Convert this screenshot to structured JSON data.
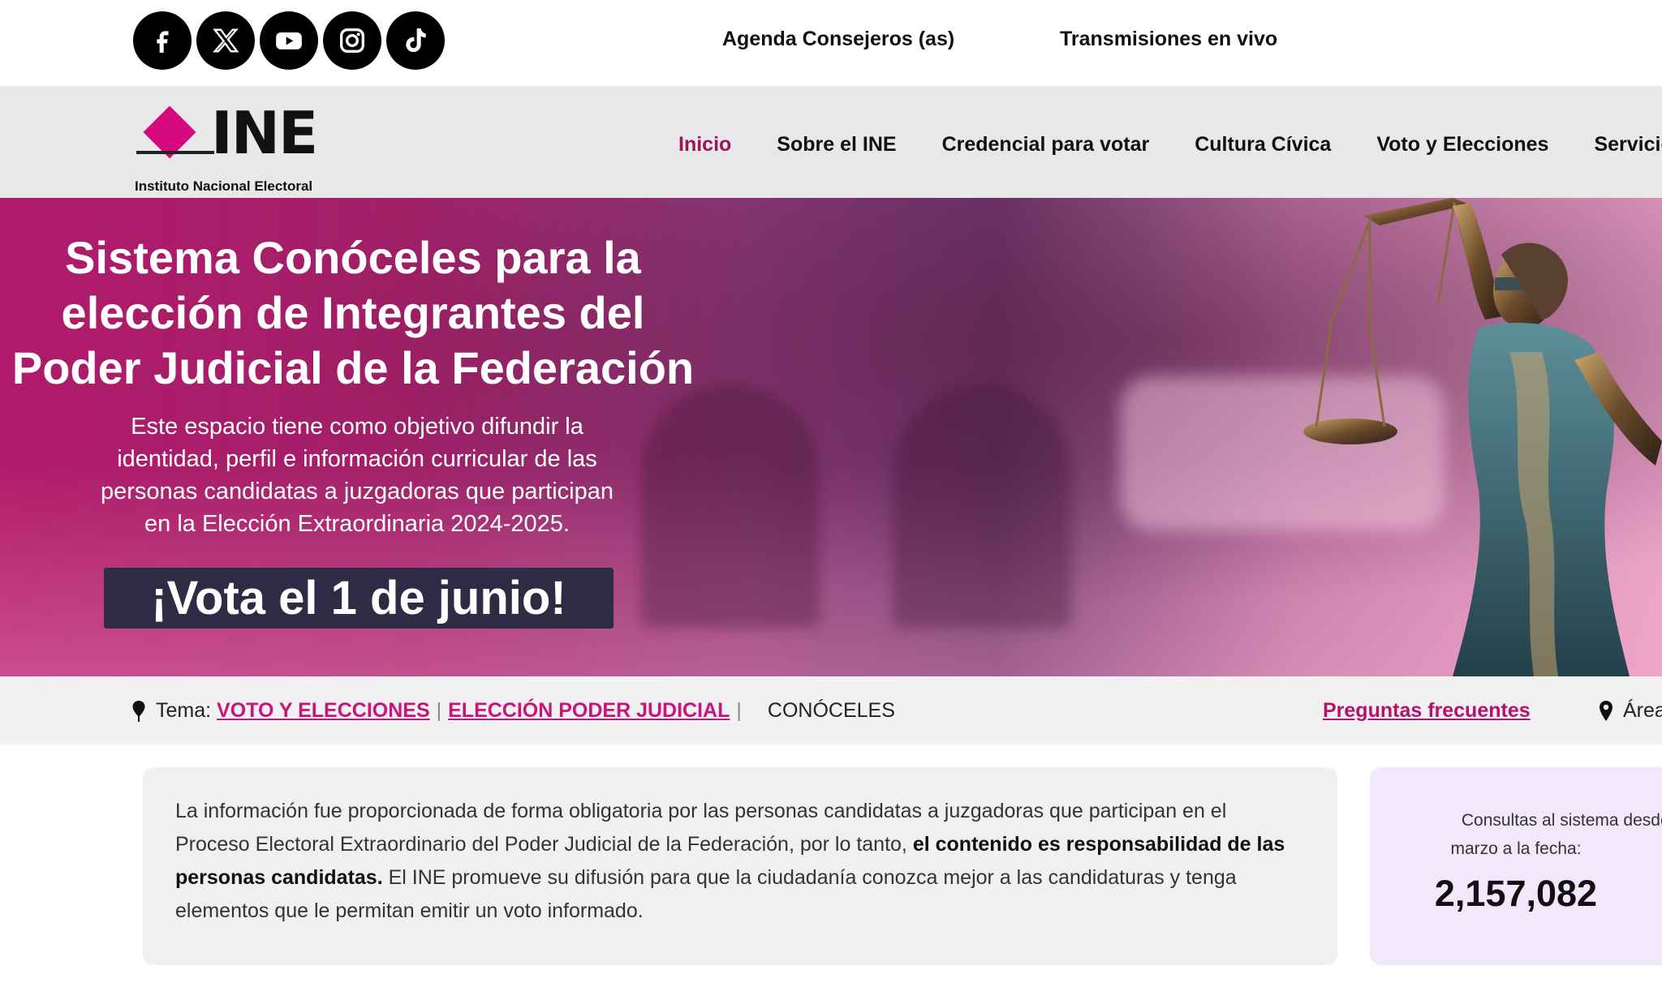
{
  "topbar": {
    "social": [
      "facebook-icon",
      "x-icon",
      "youtube-icon",
      "instagram-icon",
      "tiktok-icon"
    ],
    "links": [
      "Agenda Consejeros (as)",
      "Transmisiones en vivo"
    ]
  },
  "logo": {
    "name": "INE",
    "subtitle": "Instituto Nacional Electoral"
  },
  "nav": {
    "items": [
      "Inicio",
      "Sobre el INE",
      "Credencial para votar",
      "Cultura Cívica",
      "Voto y Elecciones",
      "Servicios"
    ],
    "active": "Inicio"
  },
  "hero": {
    "title_line1": "Sistema Conóceles para la",
    "title_line2": "elección de Integrantes del",
    "title_line3": "Poder Judicial de la Federación",
    "desc_line1": "Este espacio tiene como objetivo difundir la",
    "desc_line2": "identidad, perfil e información curricular de las",
    "desc_line3": "personas candidatas a juzgadoras que participan",
    "desc_line4": "en la Elección Extraordinaria 2024-2025.",
    "cta": "¡Vota el 1 de junio!"
  },
  "breadcrumb": {
    "prefix": "Tema:",
    "link1": "VOTO Y ELECCIONES",
    "sep": "|",
    "link2": "ELECCIÓN PODER JUDICIAL",
    "current": "CONÓCELES",
    "faq": "Preguntas frecuentes",
    "area": "Área"
  },
  "info": {
    "text_before": "La información fue proporcionada de forma obligatoria por las personas candidatas a juzgadoras que participan en el Proceso Electoral Extraordinario del Poder Judicial de la Federación, por lo tanto, ",
    "text_bold": "el contenido es responsabilidad de las personas candidatas.",
    "text_after": " El INE promueve su difusión para que la ciudadanía conozca mejor a las candidaturas y tenga elementos que le permitan emitir un voto informado."
  },
  "counter": {
    "label_line1": "Consultas al sistema desde e",
    "label_line2": "marzo a la fecha:",
    "value": "2,157,082"
  },
  "colors": {
    "brand_magenta": "#d6087d",
    "nav_active": "#9b1458",
    "link": "#c8147e",
    "cta_bg": "#2e2c44",
    "counter_bg": "#f1e8fb"
  }
}
